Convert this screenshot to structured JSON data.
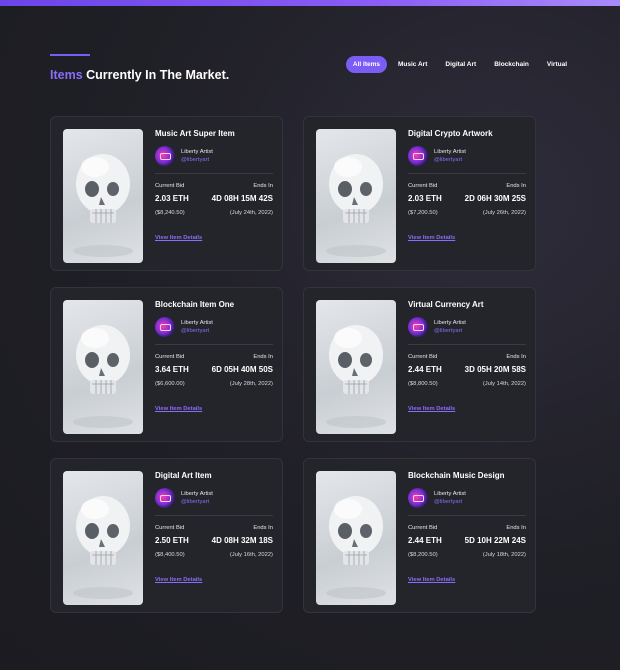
{
  "header": {
    "title_highlight": "Items",
    "title_rest": " Currently In The Market.",
    "filters": [
      {
        "label": "All Items",
        "active": true
      },
      {
        "label": "Music Art",
        "active": false
      },
      {
        "label": "Digital Art",
        "active": false
      },
      {
        "label": "Blockchain",
        "active": false
      },
      {
        "label": "Virtual",
        "active": false
      }
    ]
  },
  "labels": {
    "current_bid": "Current Bid",
    "ends_in": "Ends In",
    "details_link": "View Item Details"
  },
  "colors": {
    "accent": "#7b5cf5",
    "card_bg": "#24252b",
    "page_bg": "#1f1f26"
  },
  "items": [
    {
      "title": "Music Art Super Item",
      "artist": "Liberty Artist",
      "handle": "@libertyart",
      "bid": "2.03 ETH",
      "bid_usd": "($8,240.50)",
      "ends": "4D 08H 15M 42S",
      "ends_date": "(July 24th, 2022)",
      "image_icon": "skull-image"
    },
    {
      "title": "Digital Crypto Artwork",
      "artist": "Liberty Artist",
      "handle": "@libertyart",
      "bid": "2.03 ETH",
      "bid_usd": "($7,200.50)",
      "ends": "2D 06H 30M 25S",
      "ends_date": "(July 26th, 2022)",
      "image_icon": "skull-image"
    },
    {
      "title": "Blockchain Item One",
      "artist": "Liberty Artist",
      "handle": "@libertyart",
      "bid": "3.64 ETH",
      "bid_usd": "($6,600.00)",
      "ends": "6D 05H 40M 50S",
      "ends_date": "(July 28th, 2022)",
      "image_icon": "skull-image"
    },
    {
      "title": "Virtual Currency Art",
      "artist": "Liberty Artist",
      "handle": "@libertyart",
      "bid": "2.44 ETH",
      "bid_usd": "($8,800.50)",
      "ends": "3D 05H 20M 58S",
      "ends_date": "(July 14th, 2022)",
      "image_icon": "skull-image"
    },
    {
      "title": "Digital Art Item",
      "artist": "Liberty Artist",
      "handle": "@libertyart",
      "bid": "2.50 ETH",
      "bid_usd": "($8,400.50)",
      "ends": "4D 08H 32M 18S",
      "ends_date": "(July 16th, 2022)",
      "image_icon": "skull-image"
    },
    {
      "title": "Blockchain Music Design",
      "artist": "Liberty Artist",
      "handle": "@libertyart",
      "bid": "2.44 ETH",
      "bid_usd": "($8,200.50)",
      "ends": "5D 10H 22M 24S",
      "ends_date": "(July 18th, 2022)",
      "image_icon": "skull-image"
    }
  ]
}
